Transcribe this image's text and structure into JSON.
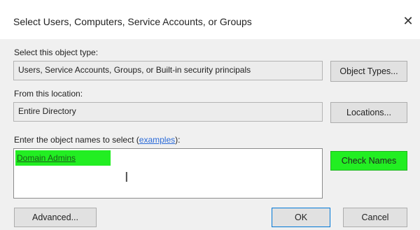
{
  "dialog": {
    "title": "Select Users, Computers, Service Accounts, or Groups",
    "close_glyph": "✕"
  },
  "object_type": {
    "label": "Select this object type:",
    "value": "Users, Service Accounts, Groups, or Built-in security principals",
    "button": "Object Types..."
  },
  "location": {
    "label": "From this location:",
    "value": "Entire Directory",
    "button": "Locations..."
  },
  "names": {
    "label_prefix": "Enter the object names to select (",
    "label_link": "examples",
    "label_suffix": "):",
    "value": "Domain Admins",
    "check_button": "Check Names"
  },
  "footer": {
    "advanced_button": "Advanced...",
    "ok_button": "OK",
    "cancel_button": "Cancel"
  },
  "colors": {
    "highlight": "#22ee22",
    "link": "#2a6ad8"
  }
}
